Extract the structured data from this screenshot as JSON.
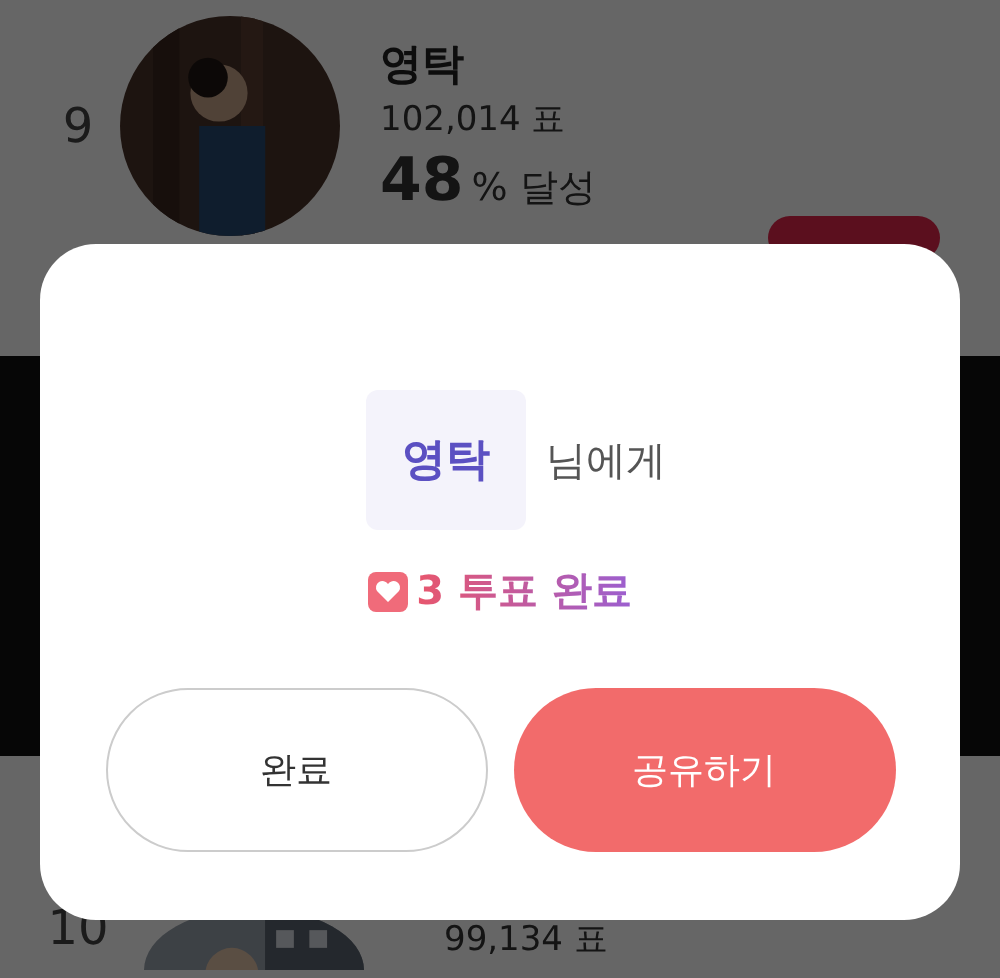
{
  "ranking": [
    {
      "rank": "9",
      "name": "영탁",
      "votes": "102,014 표",
      "percent": "48",
      "percent_unit": "% 달성"
    },
    {
      "rank": "10",
      "votes": "99,134 표"
    }
  ],
  "dialog": {
    "recipient": "영탁",
    "recipient_suffix": "님에게",
    "result": "3 투표 완료",
    "buttons": [
      {
        "label": "완료",
        "kind": "secondary"
      },
      {
        "label": "공유하기",
        "kind": "primary"
      }
    ]
  }
}
